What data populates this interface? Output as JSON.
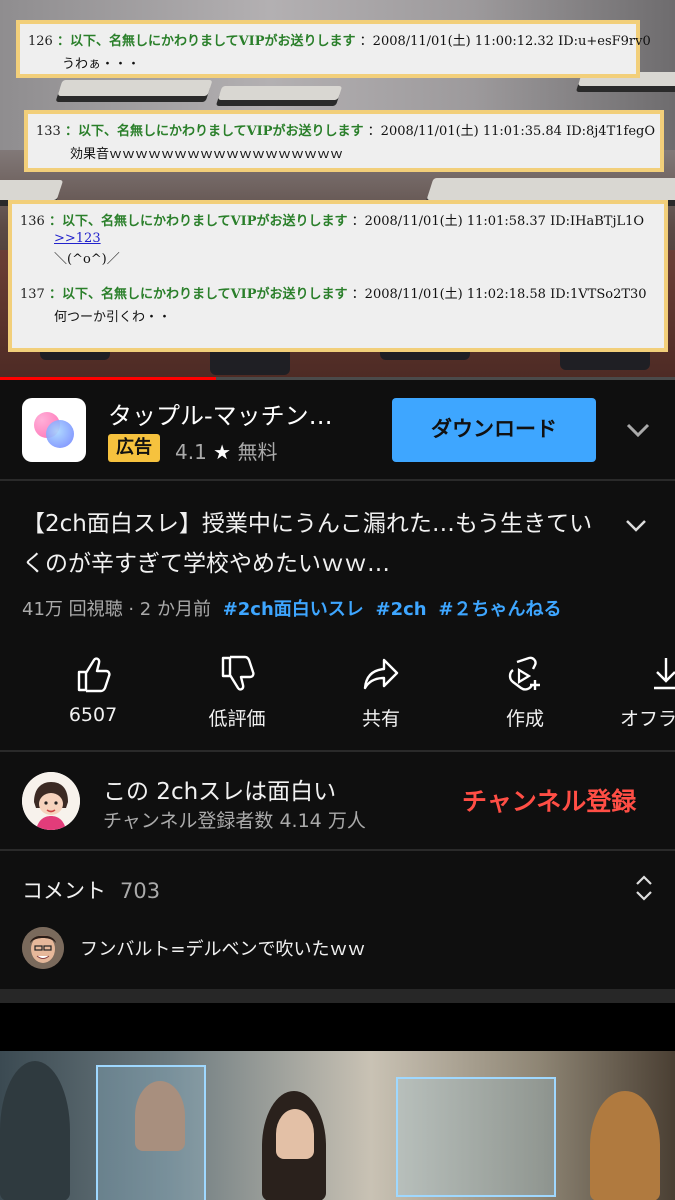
{
  "video": {
    "posts": [
      {
        "num": "126",
        "name": "：以下、名無しにかわりましてVIPがお送りします",
        "meta": "：2008/11/01(土) 11:00:12.32 ID:u+esF9rv0",
        "body": "うわぁ・・・"
      },
      {
        "num": "133",
        "name": "：以下、名無しにかわりましてVIPがお送りします",
        "meta": "：2008/11/01(土) 11:01:35.84 ID:8j4T1fegO",
        "body": "効果音ｗｗｗｗｗｗｗｗｗｗｗｗｗｗｗｗｗｗ"
      },
      {
        "num": "136",
        "name": "：以下、名無しにかわりましてVIPがお送りします",
        "meta": "：2008/11/01(土) 11:01:58.37 ID:IHaBTjL1O",
        "link": ">>123",
        "body": "＼(^o^)／"
      },
      {
        "num": "137",
        "name": "：以下、名無しにかわりましてVIPがお送りします",
        "meta": "：2008/11/01(土) 11:02:18.58 ID:1VTSo2T30",
        "body": "何つーか引くわ・・"
      }
    ],
    "progress": 0.32,
    "colors": {
      "progress": "#ff0000",
      "post_name": "#2a7f2a",
      "post_border": "#f2cf7a"
    }
  },
  "ad": {
    "title": "タップル-マッチン…",
    "badge": "広告",
    "rating": "4.1",
    "star_icon": "★",
    "price": "無料",
    "download_label": "ダウンロード",
    "accent": "#3ea6ff"
  },
  "video_info": {
    "title": "【2ch面白スレ】授業中にうんこ漏れた…もう生きていくのが辛すぎて学校やめたいｗｗ…",
    "views": "41万 回視聴 · 2 か月前",
    "hashtags": [
      "#2ch面白いスレ",
      "#2ch",
      "#２ちゃんねる"
    ]
  },
  "actions": [
    {
      "icon": "thumbs-up-icon",
      "label": "6507"
    },
    {
      "icon": "thumbs-down-icon",
      "label": "低評価"
    },
    {
      "icon": "share-icon",
      "label": "共有"
    },
    {
      "icon": "remix-icon",
      "label": "作成"
    },
    {
      "icon": "download-icon",
      "label": "オフラ"
    }
  ],
  "channel": {
    "name": "この 2chスレは面白い",
    "subscribers": "チャンネル登録者数 4.14 万人",
    "subscribe_label": "チャンネル登録",
    "subscribe_color": "#ff4e45"
  },
  "comments": {
    "header": "コメント",
    "count": "703",
    "top_comment": "フンバルト=デルベンで吹いたｗｗ"
  }
}
